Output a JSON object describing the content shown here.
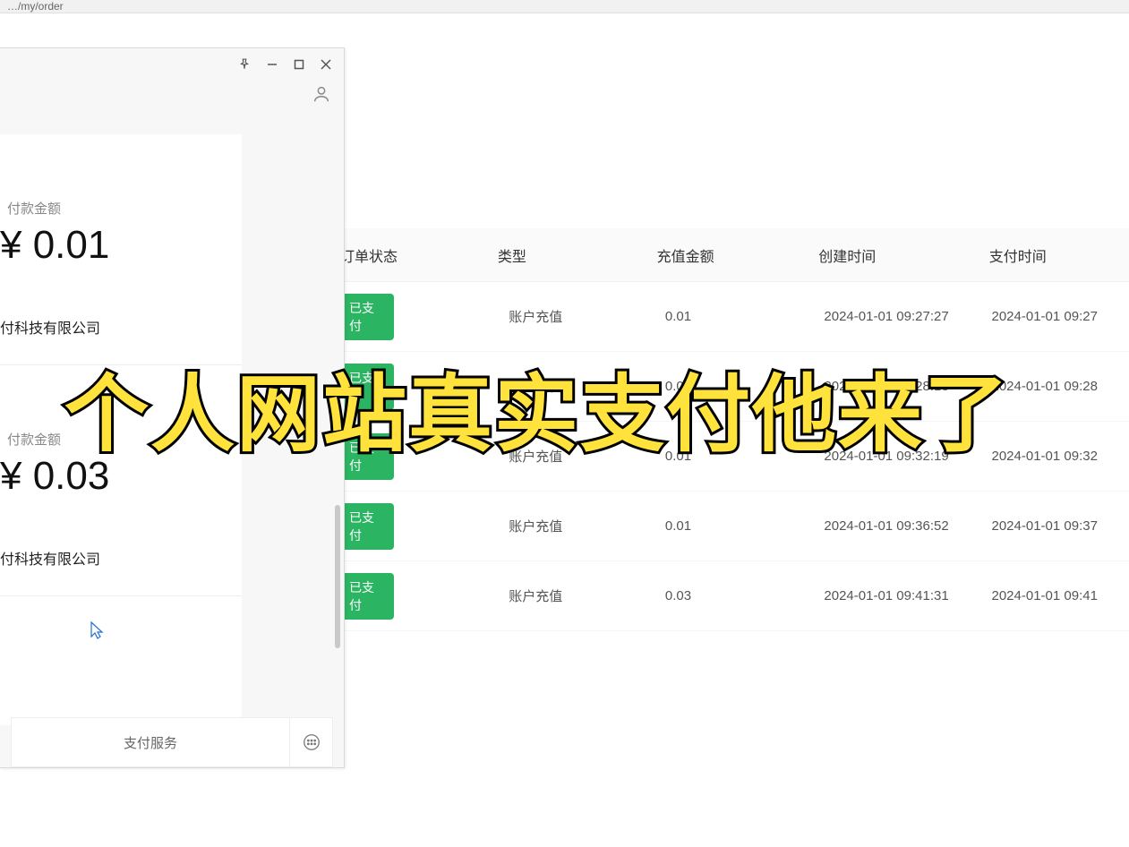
{
  "url_fragment": "…/my/order",
  "headline": "个人网站真实支付他来了",
  "popup": {
    "cards": [
      {
        "label": "付款金额",
        "amount": "¥ 0.01",
        "merchant": "付科技有限公司"
      },
      {
        "label": "付款金额",
        "amount": "¥ 0.03",
        "merchant": "付科技有限公司"
      }
    ],
    "footer_service": "支付服务"
  },
  "table": {
    "headers": {
      "status": "订单状态",
      "type": "类型",
      "amount": "充值金额",
      "create": "创建时间",
      "pay": "支付时间"
    },
    "rows": [
      {
        "status": "已支付",
        "type": "账户充值",
        "amount": "0.01",
        "create": "2024-01-01 09:27:27",
        "pay": "2024-01-01 09:27"
      },
      {
        "status": "已支付",
        "type": "账户充值",
        "amount": "0.01",
        "create": "2024-01-01 09:28:13",
        "pay": "2024-01-01 09:28"
      },
      {
        "status": "已支付",
        "type": "账户充值",
        "amount": "0.01",
        "create": "2024-01-01 09:32:19",
        "pay": "2024-01-01 09:32"
      },
      {
        "status": "已支付",
        "type": "账户充值",
        "amount": "0.01",
        "create": "2024-01-01 09:36:52",
        "pay": "2024-01-01 09:37"
      },
      {
        "status": "已支付",
        "type": "账户充值",
        "amount": "0.03",
        "create": "2024-01-01 09:41:31",
        "pay": "2024-01-01 09:41"
      }
    ]
  }
}
